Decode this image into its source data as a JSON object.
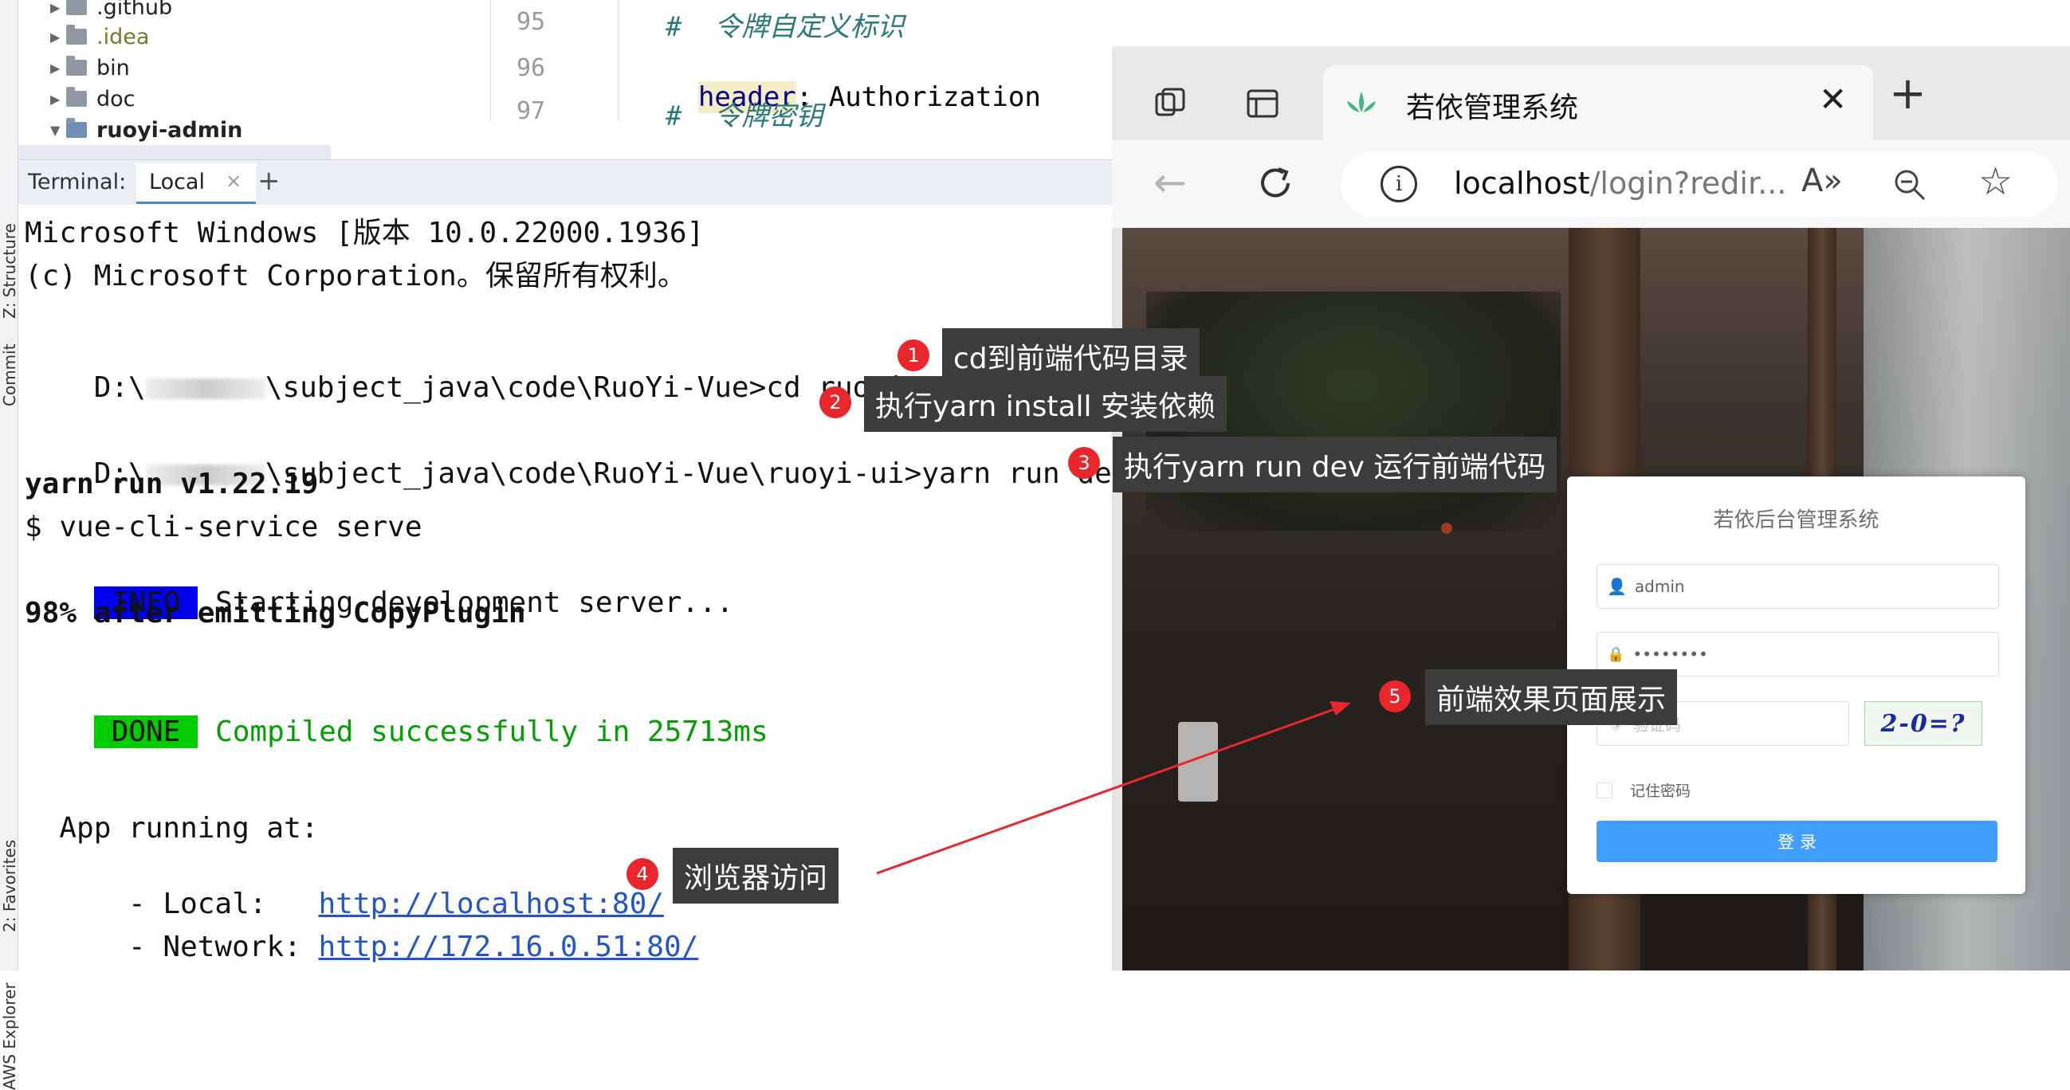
{
  "sidebar_tabs": [
    "Z: Structure",
    "Commit",
    "2: Favorites",
    "AWS Explorer"
  ],
  "project_tree": [
    {
      "label": ".github",
      "expanded": false
    },
    {
      "label": ".idea",
      "expanded": false
    },
    {
      "label": "bin",
      "expanded": false
    },
    {
      "label": "doc",
      "expanded": false
    },
    {
      "label": "ruoyi-admin",
      "expanded": true
    }
  ],
  "editor": {
    "lines": [
      {
        "num": "95",
        "text": "#  令牌自定义标识"
      },
      {
        "num": "96",
        "key": "header",
        "sep": ": ",
        "value": "Authorization"
      },
      {
        "num": "97",
        "text": "#  令牌密钥"
      }
    ]
  },
  "terminal": {
    "label": "Terminal:",
    "tab": "Local",
    "lines": [
      "Microsoft Windows [版本 10.0.22000.1936]",
      "(c) Microsoft Corporation。保留所有权利。",
      "",
      "D:\\",
      "\\subject_java\\code\\RuoYi-Vue>cd ruoyi-ui",
      "D:\\",
      "\\subject_java\\code\\RuoYi-Vue\\ruoyi-ui>yarn run dev",
      "yarn run v1.22.19",
      "$ vue-cli-service serve",
      "INFO",
      " Starting development server...",
      "98% after emitting CopyPlugin",
      "DONE",
      " Compiled successfully in 25713ms",
      "  App running at:",
      "  - Local:   ",
      "http://localhost:80/",
      "  - Network: ",
      "http://172.16.0.51:80/"
    ]
  },
  "browser": {
    "tab_title": "若依管理系统",
    "url_host": "localhost",
    "url_rest": "/login?redir...",
    "login": {
      "title": "若依后台管理系统",
      "username": "admin",
      "password": "••••••••",
      "captcha_placeholder": "验证码",
      "captcha_image_text": "2-0=?",
      "remember": "记住密码",
      "submit": "登 录"
    }
  },
  "annotations": [
    {
      "num": "1",
      "text": "cd到前端代码目录"
    },
    {
      "num": "2",
      "text": "执行yarn install 安装依赖"
    },
    {
      "num": "3",
      "text": "执行yarn run dev 运行前端代码"
    },
    {
      "num": "4",
      "text": "浏览器访问"
    },
    {
      "num": "5",
      "text": "前端效果页面展示"
    }
  ],
  "colors": {
    "info_bg": "#0000ee",
    "done_bg": "#00cc00",
    "success_text": "#00a000",
    "link": "#2255cc",
    "badge": "#e8262b",
    "login_button": "#409eff"
  }
}
